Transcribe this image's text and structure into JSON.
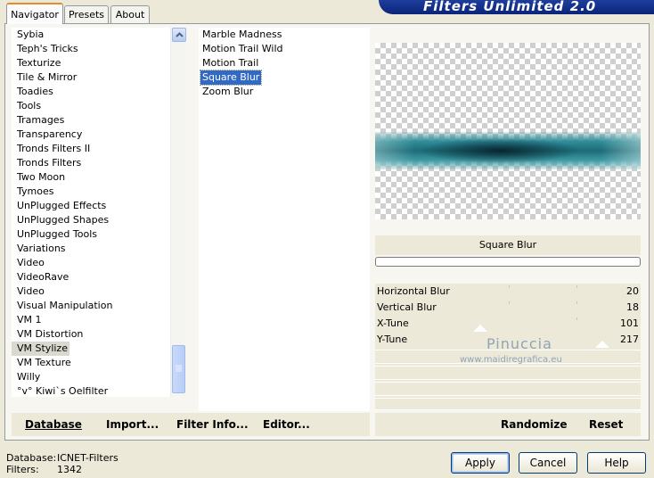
{
  "tabs": [
    "Navigator",
    "Presets",
    "About"
  ],
  "banner_title": "Filters Unlimited 2.0",
  "categories": [
    "Sybia",
    "Teph's Tricks",
    "Texturize",
    "Tile & Mirror",
    "Toadies",
    "Tools",
    "Tramages",
    "Transparency",
    "Tronds Filters II",
    "Tronds Filters",
    "Two Moon",
    "Tymoes",
    "UnPlugged Effects",
    "UnPlugged Shapes",
    "UnPlugged Tools",
    "Variations",
    "Video",
    "VideoRave",
    "Video",
    "Visual Manipulation",
    "VM 1",
    "VM Distortion",
    "VM Stylize",
    "VM Texture",
    "Willy",
    "°v° Kiwi`s Oelfilter"
  ],
  "selected_category": "VM Stylize",
  "filters": [
    "Marble Madness",
    "Motion Trail Wild",
    "Motion Trail",
    "Square Blur",
    "Zoom Blur"
  ],
  "selected_filter": "Square Blur",
  "preview": {
    "filter_title": "Square Blur"
  },
  "params": [
    {
      "label": "Horizontal Blur",
      "value": "20"
    },
    {
      "label": "Vertical Blur",
      "value": "18"
    },
    {
      "label": "X-Tune",
      "value": "101"
    },
    {
      "label": "Y-Tune",
      "value": "217"
    }
  ],
  "watermark": {
    "name": "Pinuccia",
    "url": "www.maidiregrafica.eu"
  },
  "toolbar": {
    "database": "Database",
    "import": "Import...",
    "filter_info": "Filter Info...",
    "editor": "Editor...",
    "randomize": "Randomize",
    "reset": "Reset"
  },
  "footer": {
    "database_label": "Database:",
    "database_value": "ICNET-Filters",
    "filters_label": "Filters:",
    "filters_value": "1342"
  },
  "buttons": {
    "apply": "Apply",
    "cancel": "Cancel",
    "help": "Help"
  }
}
